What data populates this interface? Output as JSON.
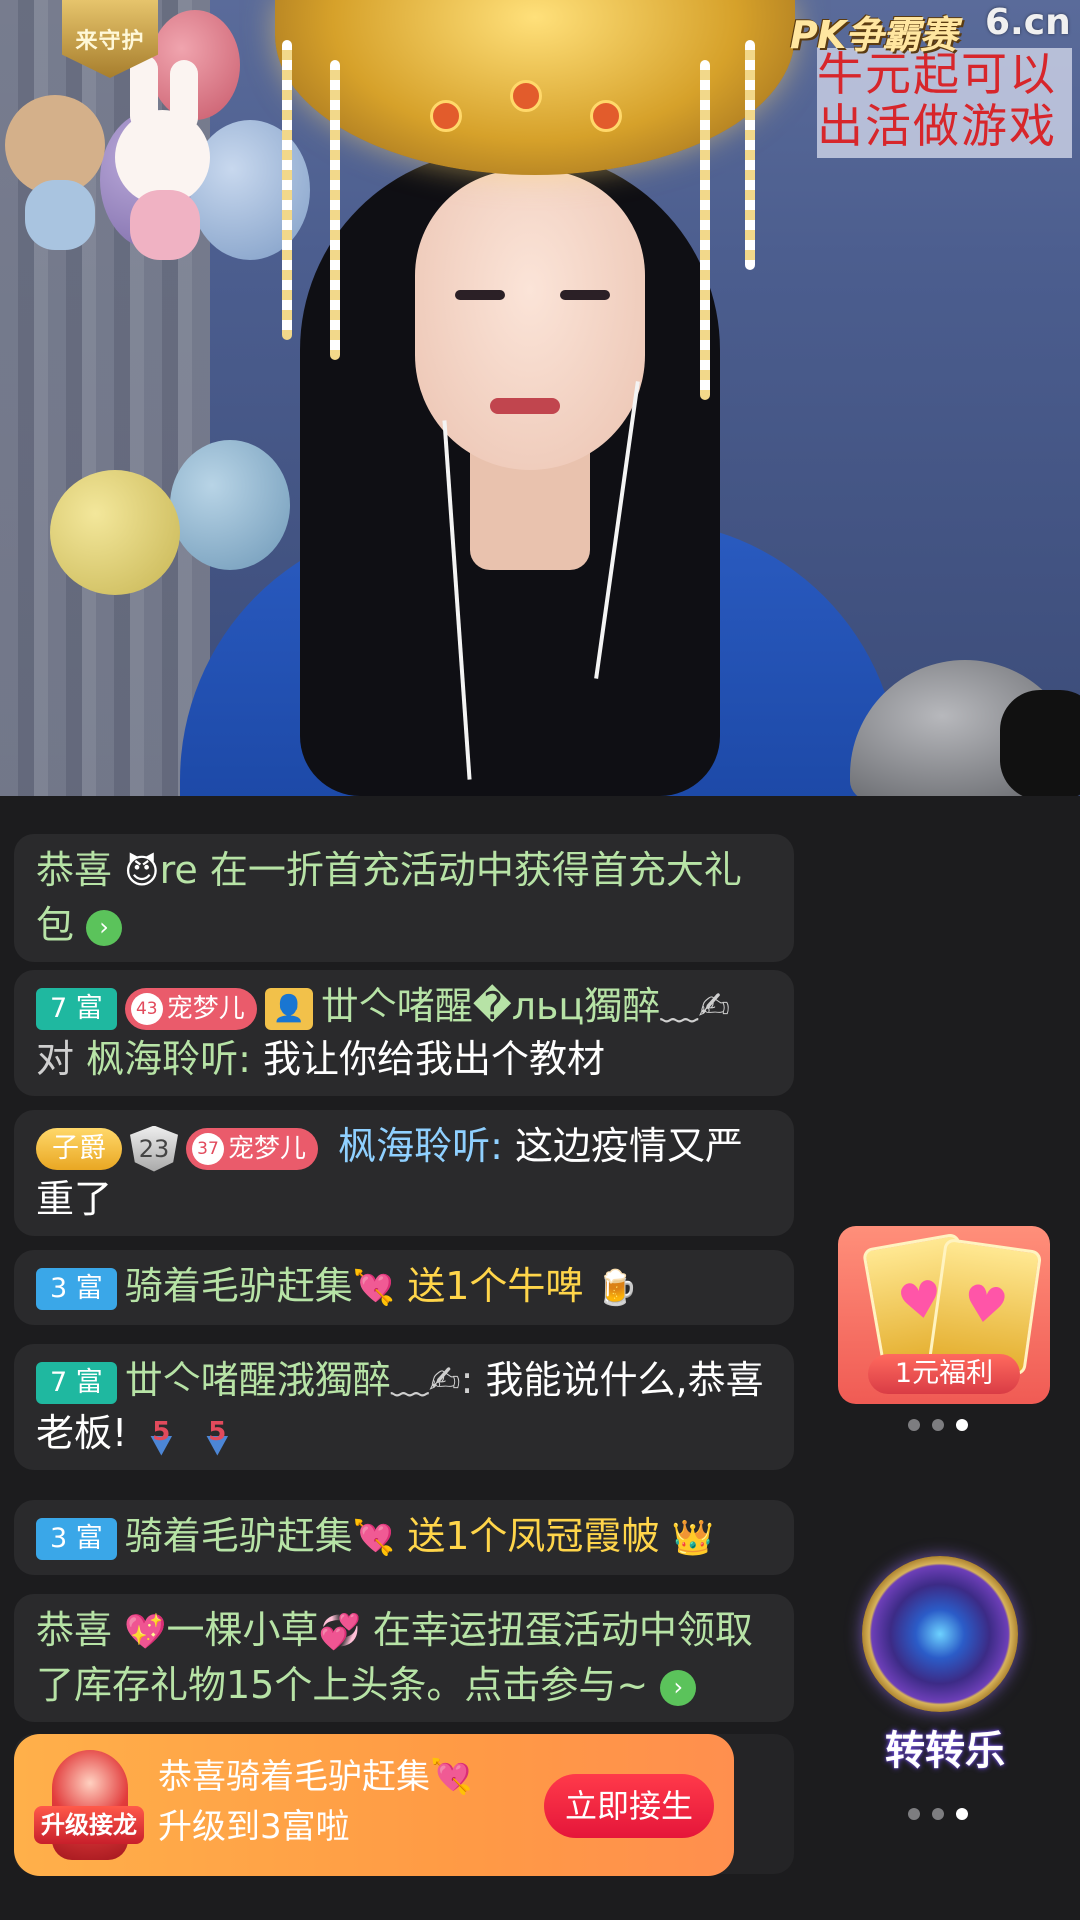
{
  "overlay": {
    "site_logo": "6.cn",
    "pk_logo": "PK争霸赛",
    "guard_badge": "来守护",
    "notice_lines": [
      "牛元起可以",
      "出活做游戏"
    ]
  },
  "chat": {
    "messages": [
      {
        "prefix": "恭喜",
        "emoji": "😈",
        "user": "re",
        "text": "在一折首充活动中获得首充大礼包"
      },
      {
        "rich_badge": "7 富",
        "pet_level": "43",
        "pet_name": "宠梦儿",
        "user": "丗亽啫醒�льц獨醉",
        "user_suffix": "﹏✍",
        "to_word": "对",
        "target": "枫海聆听:",
        "text": "我让你给我出个教材"
      },
      {
        "noble_badge": "子爵",
        "shield_level": "23",
        "pet_level": "37",
        "pet_name": "宠梦儿",
        "user": "枫海聆听:",
        "text": "这边疫情又严重了"
      },
      {
        "rich_badge": "3 富",
        "user": "骑着毛驴赶集",
        "user_suffix": "💘",
        "text": "送1个牛啤",
        "gift_icon": "🍺"
      },
      {
        "rich_badge": "7 富",
        "user": "丗亽啫醒涐獨醉",
        "user_suffix": "﹏✍:",
        "text": "我能说什么,恭喜老板!",
        "level_marks": [
          "5",
          "5"
        ]
      },
      {
        "rich_badge": "3 富",
        "user": "骑着毛驴赶集",
        "user_suffix": "💘",
        "text": "送1个凤冠霞帔",
        "gift_icon": "👑"
      },
      {
        "prefix": "恭喜",
        "pre_emoji": "💖",
        "user": "一棵小草",
        "post_emoji": "💞",
        "text": "在幸运扭蛋活动中领取了库存礼物15个上头条。点击参与~"
      }
    ]
  },
  "promo": {
    "label": "1元福利",
    "dots": 3,
    "active_dot": 2
  },
  "wheel": {
    "label": "转转乐",
    "dots": 3,
    "active_dot": 2
  },
  "upgrade": {
    "badge": "升级接龙",
    "line1": "恭喜骑着毛驴赶集💘",
    "line2": "升级到3富啦",
    "button": "立即接生"
  },
  "colors": {
    "chat_bg": "#2a2a2c",
    "name_green": "#b7e3a6",
    "name_blue": "#8fd0ff",
    "gift_gold": "#ffd54a",
    "banner_orange": "#ffa046",
    "button_red": "#e5163a"
  }
}
